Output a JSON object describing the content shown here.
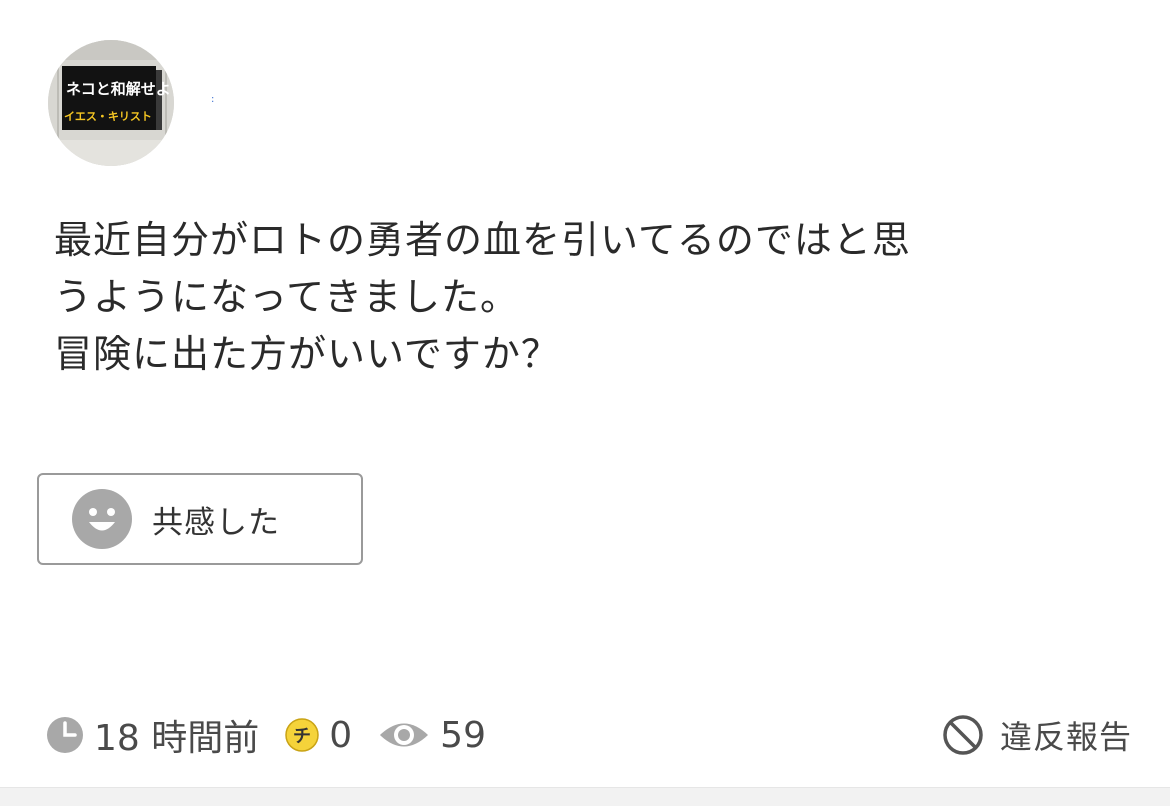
{
  "post": {
    "avatar_image": {
      "label_line1": "ネコと和解せよ",
      "label_line2": "イエス・キリスト"
    },
    "question_lines": [
      "最近自分がロトの勇者の血を引いてるのではと思",
      "うようになってきました。",
      "冒険に出た方がいいですか？"
    ]
  },
  "empathy_button": {
    "icon": "smile-face-icon",
    "label": "共感した"
  },
  "meta": {
    "time_icon": "clock-icon",
    "time_text": "18 時間前",
    "coin_icon": "chie-coin-icon",
    "coin_glyph": "チ",
    "coin_count": "0",
    "views_icon": "eye-icon",
    "view_count": "59"
  },
  "report": {
    "icon": "prohibited-icon",
    "label": "違反報告"
  },
  "colors": {
    "icon_gray": "#a8a8a8",
    "coin_yellow": "#f5d33a",
    "text": "#2b2b2b",
    "border": "#9a9a9a"
  }
}
